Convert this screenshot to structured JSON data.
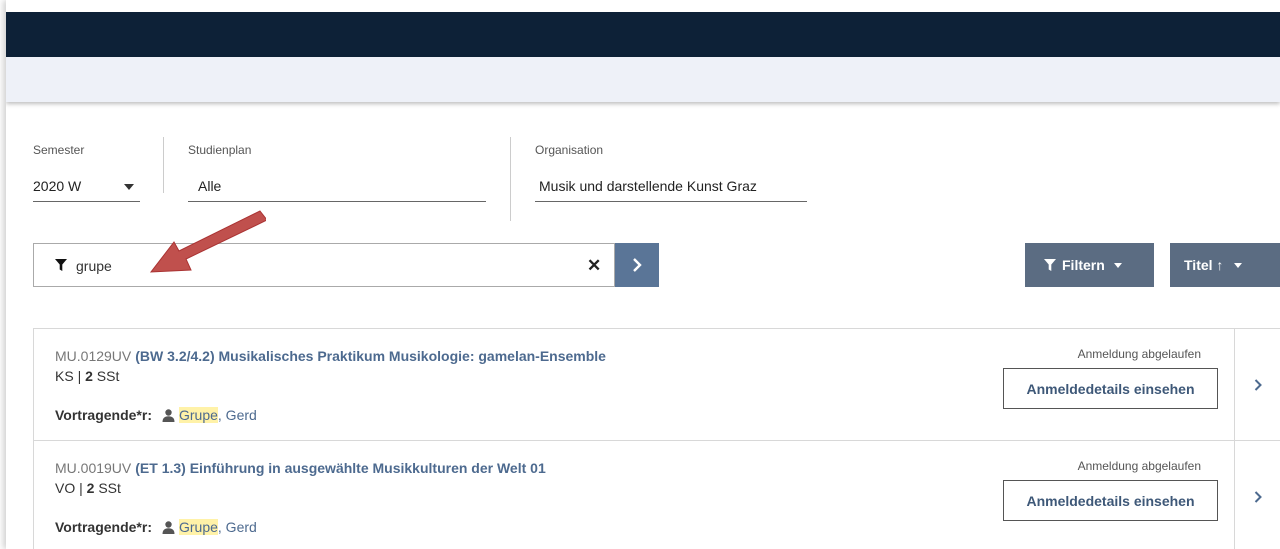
{
  "filters": {
    "semester": {
      "label": "Semester",
      "value": "2020 W"
    },
    "studienplan": {
      "label": "Studienplan",
      "value": "Alle"
    },
    "organisation": {
      "label": "Organisation",
      "value": "Musik und darstellende Kunst Graz"
    }
  },
  "search": {
    "value": "grupe"
  },
  "toolbar": {
    "filter_label": "Filtern",
    "sort_label": "Titel ↑"
  },
  "courses": [
    {
      "code": "MU.0129UV",
      "title": "(BW 3.2/4.2) Musikalisches Praktikum Musikologie: gamelan-Ensemble",
      "type": "KS",
      "hours": "2",
      "hours_unit": "SSt",
      "lecturer_label": "Vortragende*r:",
      "lecturer_last": "Grupe",
      "lecturer_first": ", Gerd",
      "status": "Anmeldung abgelaufen",
      "details_label": "Anmeldedetails einsehen"
    },
    {
      "code": "MU.0019UV",
      "title": "(ET 1.3) Einführung in ausgewählte Musikkulturen der Welt 01",
      "type": "VO",
      "hours": "2",
      "hours_unit": "SSt",
      "lecturer_label": "Vortragende*r:",
      "lecturer_last": "Grupe",
      "lecturer_first": ", Gerd",
      "status": "Anmeldung abgelaufen",
      "details_label": "Anmeldedetails einsehen"
    }
  ],
  "colors": {
    "topbar": "#0d2137",
    "subbar": "#eef1f8",
    "accent_button": "#5a7597",
    "toolbar_button": "#5b6c82",
    "highlight": "#fff2a8",
    "link": "#4d6a8f",
    "annotation_arrow": "#c0504d"
  },
  "icons": {
    "filter": "filter-funnel-icon",
    "clear": "close-icon",
    "submit": "chevron-right-icon",
    "person": "person-icon",
    "dropdown": "caret-down-icon"
  }
}
